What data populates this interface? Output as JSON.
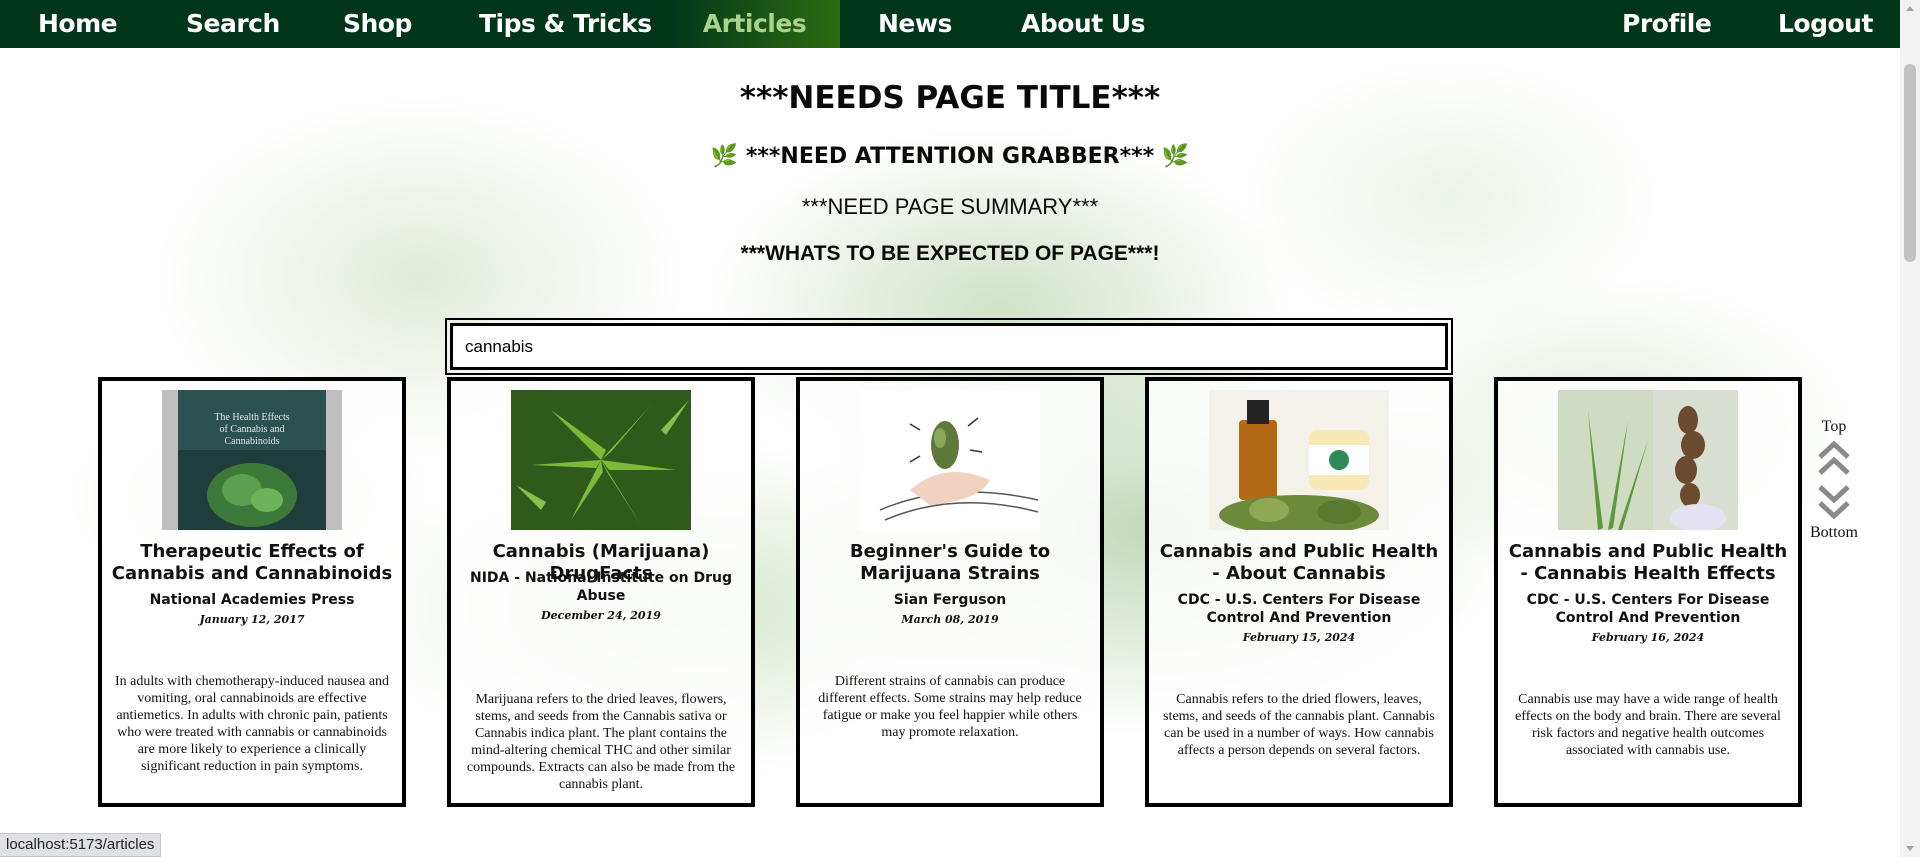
{
  "nav": {
    "home": "Home",
    "search": "Search",
    "shop": "Shop",
    "tips": "Tips & Tricks",
    "articles": "Articles",
    "news": "News",
    "about": "About Us",
    "profile": "Profile",
    "logout": "Logout",
    "active_item": "Articles"
  },
  "page": {
    "title": "***NEEDS PAGE TITLE***",
    "grabber": "***NEED ATTENTION GRABBER***",
    "summary": "***NEED PAGE SUMMARY***",
    "expect": "***WHATS TO BE EXPECTED OF PAGE***!"
  },
  "search": {
    "value": "cannabis"
  },
  "articles": [
    {
      "title": "Therapeutic Effects of Cannabis and Cannabinoids",
      "source": "National Academies Press",
      "date": "January 12, 2017",
      "description": "In adults with chemotherapy-induced nausea and vomiting, oral cannabinoids are effective antiemetics. In adults with chronic pain, patients who were treated with cannabis or cannabinoids are more likely to experience a clinically significant reduction in pain symptoms.",
      "image": "book-cover-image",
      "cover_text": "The Health Effects of Cannabis and Cannabinoids"
    },
    {
      "title": "Cannabis (Marijuana) DrugFacts",
      "source": "NIDA - National Institute on Drug Abuse",
      "date": "December 24, 2019",
      "description": "Marijuana refers to the dried leaves, flowers, stems, and seeds from the Cannabis sativa or Cannabis indica plant. The plant contains the mind-altering chemical THC and other similar compounds. Extracts can also be made from the cannabis plant.",
      "image": "cannabis-leaves-image"
    },
    {
      "title": "Beginner's Guide to Marijuana Strains",
      "source": "Sian Ferguson",
      "date": "March 08, 2019",
      "description": "Different strains of cannabis can produce different effects. Some strains may help reduce fatigue or make you feel happier while others may promote relaxation.",
      "image": "hand-holding-bud-image"
    },
    {
      "title": "Cannabis and Public Health - About Cannabis",
      "source": "CDC - U.S. Centers For Disease Control And Prevention",
      "date": "February 15, 2024",
      "description": "Cannabis refers to the dried flowers, leaves, stems, and seeds of the cannabis plant. Cannabis can be used in a number of ways. How cannabis affects a person depends on several factors.",
      "image": "oil-bottles-image"
    },
    {
      "title": "Cannabis and Public Health - Cannabis Health Effects",
      "source": "CDC - U.S. Centers For Disease Control And Prevention",
      "date": "February 16, 2024",
      "description": "Cannabis use may have a wide range of health effects on the body and brain. There are several risk factors and negative health outcomes associated with cannabis use.",
      "image": "leaf-and-stalk-image"
    }
  ],
  "scroll_controls": {
    "top": "Top",
    "bottom": "Bottom"
  },
  "status_bar": {
    "url": "localhost:5173/articles"
  },
  "colors": {
    "nav_bg": "#02361a",
    "active_text": "#a8d58a",
    "leaf": "#6aa84f"
  }
}
